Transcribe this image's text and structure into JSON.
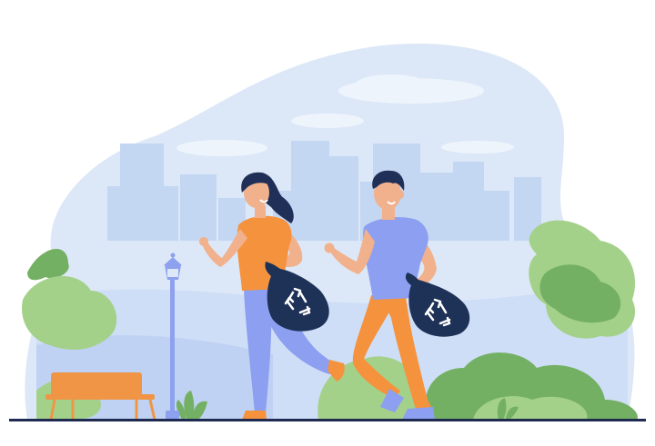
{
  "illustration": {
    "colors": {
      "sky": "#dce8f7",
      "skyline": "#c3d6f2",
      "cloud": "#eef4fc",
      "bush_light": "#a4d18a",
      "bush_dark": "#74b064",
      "ground_line": "#1e2a4f",
      "orange": "#f5923e",
      "periwinkle": "#8c9ff0",
      "skin": "#f1b18c",
      "hair": "#1f2f57",
      "bag": "#1e3257",
      "bench": "#f09545",
      "lamp": "#8ea1ee"
    },
    "icons": [
      "recycle-icon",
      "recycle-icon"
    ]
  }
}
